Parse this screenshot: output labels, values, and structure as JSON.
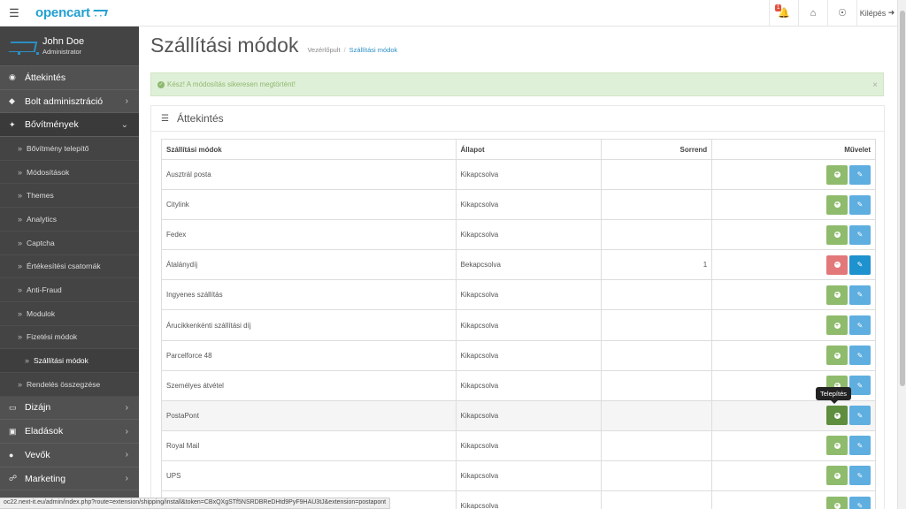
{
  "header": {
    "logo": "opencart",
    "notification_count": "1",
    "logout_label": "Kilépés"
  },
  "user": {
    "name": "John Doe",
    "role": "Administrator"
  },
  "sidebar": {
    "items": [
      {
        "label": "Áttekintés",
        "icon": "dashboard-icon",
        "has_children": false
      },
      {
        "label": "Bolt adminisztráció",
        "icon": "tag-icon",
        "has_children": true
      },
      {
        "label": "Bővítmények",
        "icon": "puzzle-icon",
        "has_children": true,
        "active": true
      }
    ],
    "submenu": [
      "Bővítmény telepítő",
      "Módosítások",
      "Themes",
      "Analytics",
      "Captcha",
      "Értékesítési csatornák",
      "Anti-Fraud",
      "Modulok",
      "Fizetési módok",
      "Szállítási módok",
      "Rendelés összegzése"
    ],
    "bottom_items": [
      {
        "label": "Dizájn",
        "icon": "monitor-icon"
      },
      {
        "label": "Eladások",
        "icon": "cart-icon"
      },
      {
        "label": "Vevők",
        "icon": "user-icon"
      },
      {
        "label": "Marketing",
        "icon": "share-icon"
      }
    ]
  },
  "page": {
    "title": "Szállítási módok",
    "breadcrumb": [
      "Vezérlőpult",
      "Szállítási módok"
    ],
    "alert": "Kész! A módosítás sikeresen megtörtént!",
    "panel_title": "Áttekintés"
  },
  "table": {
    "headers": [
      "Szállítási módok",
      "Állapot",
      "Sorrend",
      "Művelet"
    ],
    "rows": [
      {
        "name": "Ausztrál posta",
        "status": "Kikapcsolva",
        "order": "",
        "installed": false
      },
      {
        "name": "Citylink",
        "status": "Kikapcsolva",
        "order": "",
        "installed": false
      },
      {
        "name": "Fedex",
        "status": "Kikapcsolva",
        "order": "",
        "installed": false
      },
      {
        "name": "Átalánydíj",
        "status": "Bekapcsolva",
        "order": "1",
        "installed": true
      },
      {
        "name": "Ingyenes szállítás",
        "status": "Kikapcsolva",
        "order": "",
        "installed": false
      },
      {
        "name": "Árucikkenkénti szállítási díj",
        "status": "Kikapcsolva",
        "order": "",
        "installed": false
      },
      {
        "name": "Parcelforce 48",
        "status": "Kikapcsolva",
        "order": "",
        "installed": false
      },
      {
        "name": "Személyes átvétel",
        "status": "Kikapcsolva",
        "order": "",
        "installed": false
      },
      {
        "name": "PostaPont",
        "status": "Kikapcsolva",
        "order": "",
        "installed": false
      },
      {
        "name": "Royal Mail",
        "status": "Kikapcsolva",
        "order": "",
        "installed": false
      },
      {
        "name": "UPS",
        "status": "Kikapcsolva",
        "order": "",
        "installed": false
      },
      {
        "name": "",
        "status": "Kikapcsolva",
        "order": "",
        "installed": false
      }
    ]
  },
  "tooltip": "Telepítés",
  "status_url": "oc22.next-it.eu/admin/index.php?route=extension/shipping/install&token=CBxQXgSTf5NSRDBReDHtd9PyF9HAU3tJ&extension=postapont"
}
